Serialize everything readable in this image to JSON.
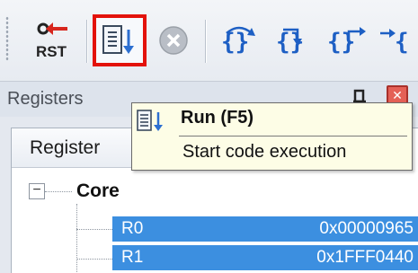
{
  "toolbar": {
    "reset_label": "RST",
    "buttons": [
      {
        "name": "reset",
        "icon": "reset-icon"
      },
      {
        "name": "run",
        "icon": "run-icon",
        "highlighted": true,
        "highlight_color": "#e3120b"
      },
      {
        "name": "stop",
        "icon": "stop-icon",
        "state": "disabled"
      },
      {
        "name": "step-over",
        "icon": "step-over-icon"
      },
      {
        "name": "step-into",
        "icon": "step-into-icon"
      },
      {
        "name": "step-out",
        "icon": "step-out-icon"
      },
      {
        "name": "run-to-cursor",
        "icon": "run-to-cursor-icon"
      }
    ]
  },
  "tooltip": {
    "title": "Run (F5)",
    "description": "Start code execution"
  },
  "panel": {
    "title": "Registers",
    "column_header": "Register",
    "tree": {
      "group_label": "Core",
      "rows": [
        {
          "name": "R0",
          "value": "0x00000965"
        },
        {
          "name": "R1",
          "value": "0x1FFF0440"
        }
      ]
    }
  },
  "colors": {
    "selection": "#3c8fe0",
    "tooltip_bg": "#fdfde6",
    "step_icon": "#1d5fc4"
  }
}
